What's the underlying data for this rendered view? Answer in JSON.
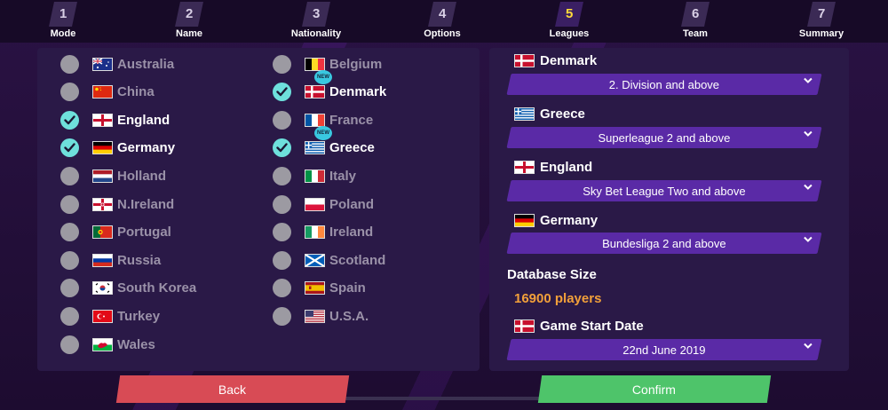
{
  "steps": [
    {
      "num": "1",
      "label": "Mode"
    },
    {
      "num": "2",
      "label": "Name"
    },
    {
      "num": "3",
      "label": "Nationality"
    },
    {
      "num": "4",
      "label": "Options"
    },
    {
      "num": "5",
      "label": "Leagues"
    },
    {
      "num": "6",
      "label": "Team"
    },
    {
      "num": "7",
      "label": "Summary"
    }
  ],
  "active_step": "5",
  "nations_left": [
    {
      "name": "Australia",
      "checked": false,
      "flag": "australia-flag-icon"
    },
    {
      "name": "China",
      "checked": false,
      "flag": "china-flag-icon"
    },
    {
      "name": "England",
      "checked": true,
      "flag": "england-flag-icon"
    },
    {
      "name": "Germany",
      "checked": true,
      "flag": "germany-flag-icon"
    },
    {
      "name": "Holland",
      "checked": false,
      "flag": "holland-flag-icon"
    },
    {
      "name": "N.Ireland",
      "checked": false,
      "flag": "northern-ireland-flag-icon"
    },
    {
      "name": "Portugal",
      "checked": false,
      "flag": "portugal-flag-icon"
    },
    {
      "name": "Russia",
      "checked": false,
      "flag": "russia-flag-icon"
    },
    {
      "name": "South Korea",
      "checked": false,
      "flag": "south-korea-flag-icon"
    },
    {
      "name": "Turkey",
      "checked": false,
      "flag": "turkey-flag-icon"
    },
    {
      "name": "Wales",
      "checked": false,
      "flag": "wales-flag-icon"
    }
  ],
  "nations_right": [
    {
      "name": "Belgium",
      "checked": false,
      "flag": "belgium-flag-icon"
    },
    {
      "name": "Denmark",
      "checked": true,
      "new": "NEW",
      "flag": "denmark-flag-icon"
    },
    {
      "name": "France",
      "checked": false,
      "flag": "france-flag-icon"
    },
    {
      "name": "Greece",
      "checked": true,
      "new": "NEW",
      "flag": "greece-flag-icon"
    },
    {
      "name": "Italy",
      "checked": false,
      "flag": "italy-flag-icon"
    },
    {
      "name": "Poland",
      "checked": false,
      "flag": "poland-flag-icon"
    },
    {
      "name": "Ireland",
      "checked": false,
      "flag": "ireland-flag-icon"
    },
    {
      "name": "Scotland",
      "checked": false,
      "flag": "scotland-flag-icon"
    },
    {
      "name": "Spain",
      "checked": false,
      "flag": "spain-flag-icon"
    },
    {
      "name": "U.S.A.",
      "checked": false,
      "flag": "usa-flag-icon"
    }
  ],
  "leagues": [
    {
      "nation": "Denmark",
      "level": "2. Division and above",
      "flag": "denmark-flag-icon"
    },
    {
      "nation": "Greece",
      "level": "Superleague 2 and above",
      "flag": "greece-flag-icon"
    },
    {
      "nation": "England",
      "level": "Sky Bet League Two and above",
      "flag": "england-flag-icon"
    },
    {
      "nation": "Germany",
      "level": "Bundesliga 2 and above",
      "flag": "germany-flag-icon"
    }
  ],
  "database": {
    "title": "Database Size",
    "value": "16900 players"
  },
  "start_date": {
    "label": "Game Start Date",
    "value": "22nd June 2019",
    "flag": "denmark-flag-icon"
  },
  "buttons": {
    "back": "Back",
    "confirm": "Confirm"
  },
  "colors": {
    "check_on": "#6ee0dc",
    "dropdown": "#5a2aa6",
    "back": "#d84b55",
    "confirm": "#4ec46a",
    "db_value": "#f2a03a",
    "active_step": "#ffdc3a"
  }
}
